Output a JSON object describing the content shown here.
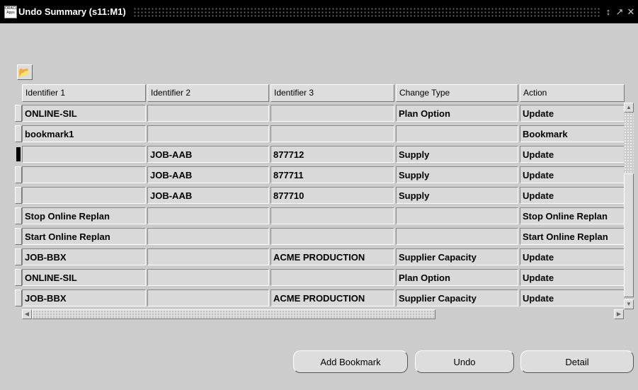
{
  "window": {
    "title": "Undo Summary (s11:M1)",
    "app_icon_text": "ORACLE Applications",
    "buttons": [
      "minimize-icon",
      "maximize-icon",
      "close-icon"
    ]
  },
  "toolbar": {
    "export_icon": "export-icon"
  },
  "table": {
    "headers": [
      "Identifier 1",
      "Identifier 2",
      "Identifier 3",
      "Change Type",
      "Action"
    ],
    "current_row": 2,
    "rows": [
      [
        "ONLINE-SIL",
        "",
        "",
        "Plan Option",
        "Update"
      ],
      [
        "bookmark1",
        "",
        "",
        "",
        "Bookmark"
      ],
      [
        "",
        "JOB-AAB",
        "877712",
        "Supply",
        "Update"
      ],
      [
        "",
        "JOB-AAB",
        "877711",
        "Supply",
        "Update"
      ],
      [
        "",
        "JOB-AAB",
        "877710",
        "Supply",
        "Update"
      ],
      [
        "Stop Online Replan",
        "",
        "",
        "",
        "Stop Online Replan"
      ],
      [
        "Start Online Replan",
        "",
        "",
        "",
        "Start Online Replan"
      ],
      [
        "JOB-BBX",
        "",
        "ACME PRODUCTION",
        "Supplier Capacity",
        "Update"
      ],
      [
        "ONLINE-SIL",
        "",
        "",
        "Plan Option",
        "Update"
      ],
      [
        "JOB-BBX",
        "",
        "ACME PRODUCTION",
        "Supplier Capacity",
        "Update"
      ]
    ]
  },
  "actions": {
    "add_bookmark": "Add Bookmark",
    "undo": "Undo",
    "detail": "Detail"
  }
}
